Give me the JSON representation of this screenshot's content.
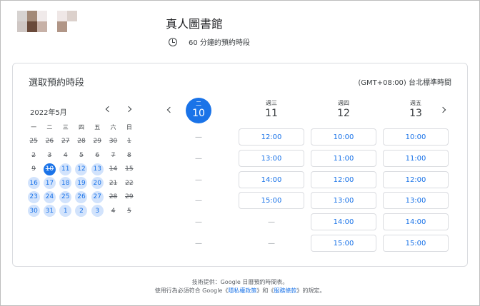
{
  "header": {
    "title": "真人圖書館",
    "duration": "60 分鐘的預約時段",
    "logo_colors": [
      "#d7d3d1",
      "#a38a78",
      "#f0eaea",
      "#ffffff",
      "#efe7e6",
      "#dcd1cc",
      "#cfc7c4",
      "#6a4a3a",
      "#c7b1a7",
      "#ffffff",
      "#b19687",
      "#ffffff"
    ]
  },
  "booking": {
    "title": "選取預約時段",
    "timezone": "(GMT+08:00) 台北標準時間"
  },
  "calendar": {
    "month_label": "2022年5月",
    "weekdays": [
      "一",
      "二",
      "三",
      "四",
      "五",
      "六",
      "日"
    ],
    "weeks": [
      [
        {
          "n": "25",
          "s": "past"
        },
        {
          "n": "26",
          "s": "past"
        },
        {
          "n": "27",
          "s": "past"
        },
        {
          "n": "28",
          "s": "past"
        },
        {
          "n": "29",
          "s": "past"
        },
        {
          "n": "30",
          "s": "past"
        },
        {
          "n": "1",
          "s": "past"
        }
      ],
      [
        {
          "n": "2",
          "s": "past"
        },
        {
          "n": "3",
          "s": "past"
        },
        {
          "n": "4",
          "s": "past"
        },
        {
          "n": "5",
          "s": "past"
        },
        {
          "n": "6",
          "s": "past"
        },
        {
          "n": "7",
          "s": "past"
        },
        {
          "n": "8",
          "s": "past"
        }
      ],
      [
        {
          "n": "9",
          "s": "past"
        },
        {
          "n": "10",
          "s": "sel"
        },
        {
          "n": "11",
          "s": "avail"
        },
        {
          "n": "12",
          "s": "avail"
        },
        {
          "n": "13",
          "s": "avail"
        },
        {
          "n": "14",
          "s": "past"
        },
        {
          "n": "15",
          "s": "past"
        }
      ],
      [
        {
          "n": "16",
          "s": "avail"
        },
        {
          "n": "17",
          "s": "avail"
        },
        {
          "n": "18",
          "s": "avail"
        },
        {
          "n": "19",
          "s": "avail"
        },
        {
          "n": "20",
          "s": "avail"
        },
        {
          "n": "21",
          "s": "past"
        },
        {
          "n": "22",
          "s": "past"
        }
      ],
      [
        {
          "n": "23",
          "s": "avail"
        },
        {
          "n": "24",
          "s": "avail"
        },
        {
          "n": "25",
          "s": "avail"
        },
        {
          "n": "26",
          "s": "avail"
        },
        {
          "n": "27",
          "s": "avail"
        },
        {
          "n": "28",
          "s": "past"
        },
        {
          "n": "29",
          "s": "past"
        }
      ],
      [
        {
          "n": "30",
          "s": "avail"
        },
        {
          "n": "31",
          "s": "avail"
        },
        {
          "n": "1",
          "s": "avail"
        },
        {
          "n": "2",
          "s": "avail"
        },
        {
          "n": "3",
          "s": "avail"
        },
        {
          "n": "4",
          "s": "past"
        },
        {
          "n": "5",
          "s": "past"
        }
      ]
    ]
  },
  "days": [
    {
      "dow": "二",
      "day": "10",
      "today": true,
      "slots": [
        "—",
        "—",
        "—",
        "—",
        "—",
        "—"
      ]
    },
    {
      "dow": "週三",
      "day": "11",
      "today": false,
      "slots": [
        "12:00",
        "13:00",
        "14:00",
        "15:00",
        "—",
        "—"
      ]
    },
    {
      "dow": "週四",
      "day": "12",
      "today": false,
      "slots": [
        "10:00",
        "11:00",
        "12:00",
        "13:00",
        "14:00",
        "15:00"
      ]
    },
    {
      "dow": "週五",
      "day": "13",
      "today": false,
      "slots": [
        "10:00",
        "11:00",
        "12:00",
        "13:00",
        "14:00",
        "15:00"
      ]
    }
  ],
  "footer": {
    "line1": "技術提供：Google 日曆預約時間表。",
    "line2_prefix": "使用行為必須符合 Google《",
    "privacy": "隱私權政策",
    "line2_mid": "》和《",
    "terms": "服務條款",
    "line2_suffix": "》的規定。"
  },
  "colors": {
    "accent": "#1a73e8",
    "available_bg": "#d2e3fc"
  }
}
